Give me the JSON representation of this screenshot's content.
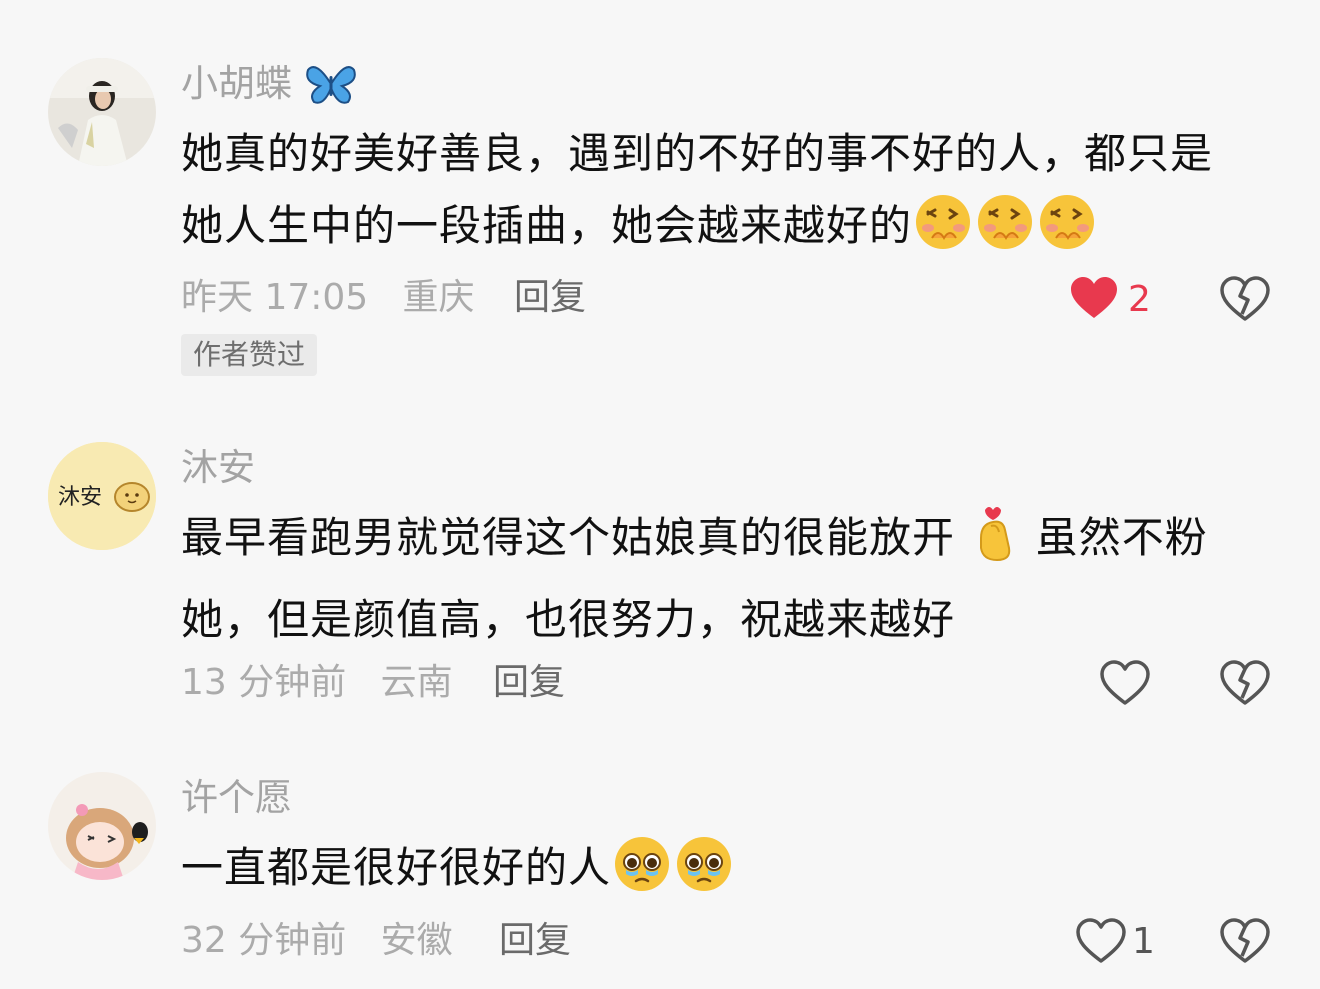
{
  "comments": [
    {
      "username": "小胡蝶",
      "text_line1": "她真的好美好善良，遇到的不好的事不好的人，都只是",
      "text_line2": "她人生中的一段插曲，她会越来越好的",
      "time": "昨天 17:05",
      "location": "重庆",
      "reply_label": "回复",
      "likes": "2",
      "liked": true,
      "badge": "作者赞过",
      "username_icon": "butterfly-icon",
      "emojis": [
        "shy-face-emoji",
        "shy-face-emoji",
        "shy-face-emoji"
      ]
    },
    {
      "username": "沐安",
      "avatar_text": "沐安",
      "text_line1a": "最早看跑男就觉得这个姑娘真的很能放开",
      "text_line1b": "虽然不粉",
      "text_line2": "她，但是颜值高，也很努力，祝越来越好",
      "time": "13 分钟前",
      "location": "云南",
      "reply_label": "回复",
      "liked": false,
      "emojis": [
        "finger-heart-emoji"
      ]
    },
    {
      "username": "许个愿",
      "text_line1": "一直都是很好很好的人",
      "time": "32 分钟前",
      "location": "安徽",
      "reply_label": "回复",
      "likes": "1",
      "liked": false,
      "emojis": [
        "pleading-face-emoji",
        "pleading-face-emoji"
      ]
    }
  ],
  "colors": {
    "background": "#f7f7f7",
    "like_active": "#e8394e",
    "meta_text": "#ababab",
    "body_text": "#111111"
  }
}
